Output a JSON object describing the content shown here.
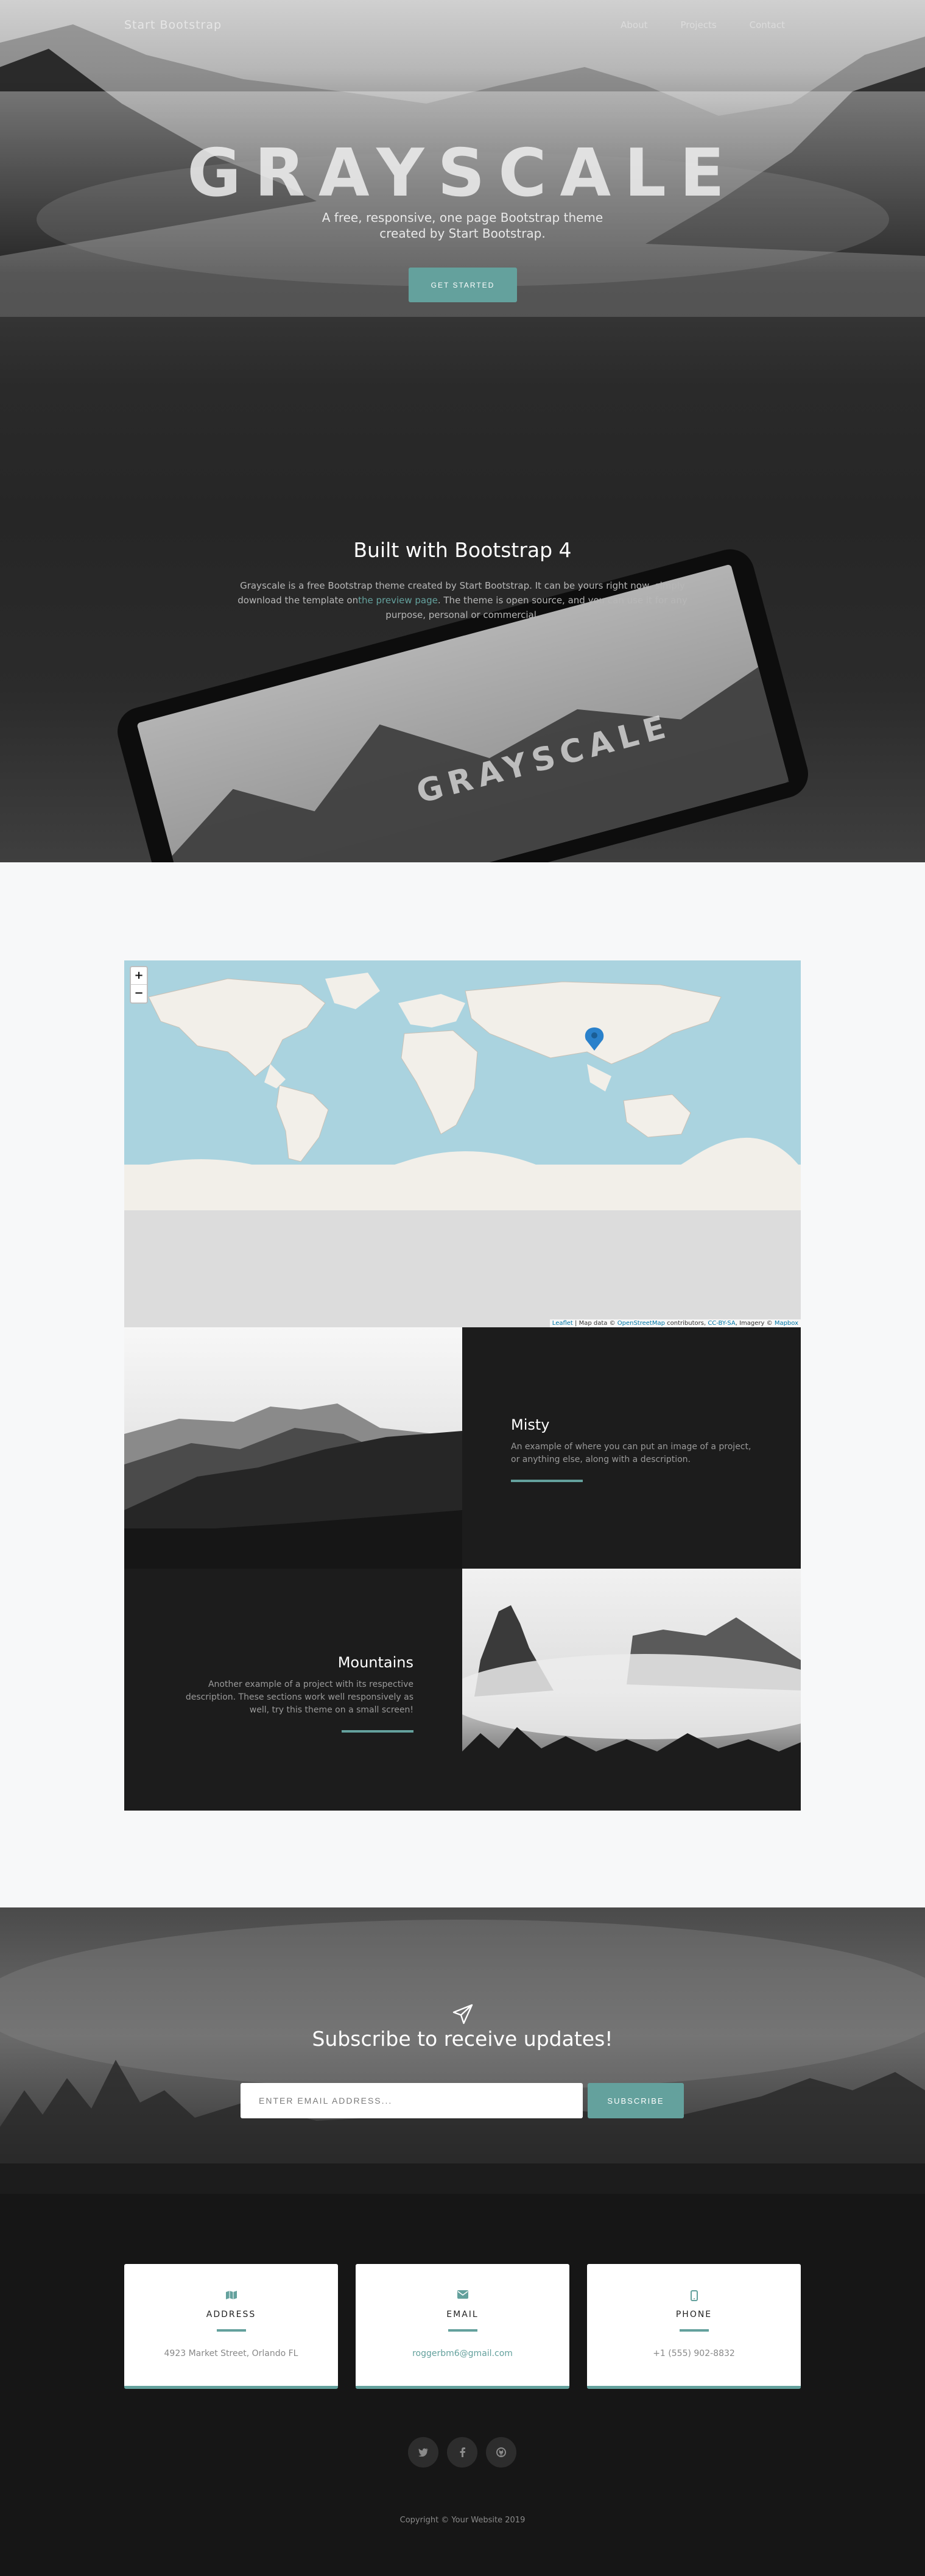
{
  "nav": {
    "brand": "Start Bootstrap",
    "links": [
      "About",
      "Projects",
      "Contact"
    ]
  },
  "hero": {
    "title": "GRAYSCALE",
    "subtitle_line1": "A free, responsive, one page Bootstrap theme",
    "subtitle_line2": "created by Start Bootstrap.",
    "button": "GET STARTED"
  },
  "about": {
    "title": "Built with Bootstrap 4",
    "text_before_link": "Grayscale is a free Bootstrap theme created by Start Bootstrap. It can be yours right now, simply download the template on",
    "link": "the preview page",
    "text_after_link": ". The theme is open source, and you can use it for any purpose, personal or commercial.",
    "tablet_title": "GRAYSCALE"
  },
  "map": {
    "zoom_in": "+",
    "zoom_out": "−",
    "attribution_leaflet": "Leaflet",
    "attribution_mid": " | Map data © ",
    "attribution_osm": "OpenStreetMap",
    "attribution_contrib": " contributors, ",
    "attribution_cc": "CC-BY-SA",
    "attribution_imagery": ", Imagery © ",
    "attribution_mapbox": "Mapbox"
  },
  "projects": [
    {
      "title": "Misty",
      "description": "An example of where you can put an image of a project, or anything else, along with a description."
    },
    {
      "title": "Mountains",
      "description": "Another example of a project with its respective description. These sections work well responsively as well, try this theme on a small screen!"
    }
  ],
  "signup": {
    "title": "Subscribe to receive updates!",
    "placeholder": "ENTER EMAIL ADDRESS...",
    "button": "SUBSCRIBE"
  },
  "contact": {
    "cards": [
      {
        "icon": "map-icon",
        "label": "ADDRESS",
        "value": "4923 Market Street, Orlando FL"
      },
      {
        "icon": "envelope-icon",
        "label": "EMAIL",
        "value": "roggerbm6@gmail.com"
      },
      {
        "icon": "mobile-icon",
        "label": "PHONE",
        "value": "+1 (555) 902-8832"
      }
    ],
    "social": [
      "twitter-icon",
      "facebook-icon",
      "github-icon"
    ]
  },
  "footer": {
    "copyright": "Copyright © Your Website 2019"
  },
  "colors": {
    "accent": "#64a19d",
    "dark": "#161616",
    "light_bg": "#f7f8f9"
  }
}
